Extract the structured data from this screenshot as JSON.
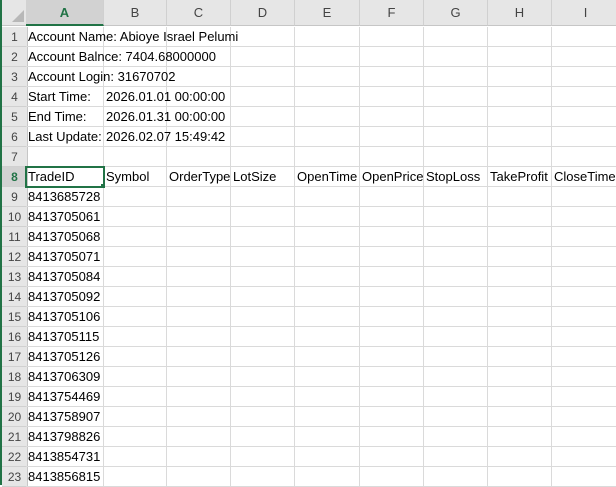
{
  "columns": [
    "A",
    "B",
    "C",
    "D",
    "E",
    "F",
    "G",
    "H",
    "I"
  ],
  "selected_cell": "A8",
  "rows": [
    {
      "num": "1",
      "cells": [
        "Account Name: Abioye Israel Pelumi",
        "",
        "",
        "",
        "",
        "",
        "",
        "",
        ""
      ]
    },
    {
      "num": "2",
      "cells": [
        "Account Balnce: 7404.68000000",
        "",
        "",
        "",
        "",
        "",
        "",
        "",
        ""
      ]
    },
    {
      "num": "3",
      "cells": [
        "Account Login: 31670702",
        "",
        "",
        "",
        "",
        "",
        "",
        "",
        ""
      ]
    },
    {
      "num": "4",
      "cells": [
        "Start Time:",
        "2026.01.01 00:00:00",
        "",
        "",
        "",
        "",
        "",
        "",
        ""
      ]
    },
    {
      "num": "5",
      "cells": [
        "End Time:",
        "2026.01.31 00:00:00",
        "",
        "",
        "",
        "",
        "",
        "",
        ""
      ]
    },
    {
      "num": "6",
      "cells": [
        "Last Update:",
        "2026.02.07 15:49:42",
        "",
        "",
        "",
        "",
        "",
        "",
        ""
      ]
    },
    {
      "num": "7",
      "cells": [
        "",
        "",
        "",
        "",
        "",
        "",
        "",
        "",
        ""
      ]
    },
    {
      "num": "8",
      "cells": [
        "TradeID",
        "Symbol",
        "OrderType",
        "LotSize",
        "OpenTime",
        "OpenPrice",
        "StopLoss",
        "TakeProfit",
        "CloseTime"
      ]
    },
    {
      "num": "9",
      "cells": [
        "8413685728",
        "",
        "",
        "",
        "",
        "",
        "",
        "",
        ""
      ]
    },
    {
      "num": "10",
      "cells": [
        "8413705061",
        "",
        "",
        "",
        "",
        "",
        "",
        "",
        ""
      ]
    },
    {
      "num": "11",
      "cells": [
        "8413705068",
        "",
        "",
        "",
        "",
        "",
        "",
        "",
        ""
      ]
    },
    {
      "num": "12",
      "cells": [
        "8413705071",
        "",
        "",
        "",
        "",
        "",
        "",
        "",
        ""
      ]
    },
    {
      "num": "13",
      "cells": [
        "8413705084",
        "",
        "",
        "",
        "",
        "",
        "",
        "",
        ""
      ]
    },
    {
      "num": "14",
      "cells": [
        "8413705092",
        "",
        "",
        "",
        "",
        "",
        "",
        "",
        ""
      ]
    },
    {
      "num": "15",
      "cells": [
        "8413705106",
        "",
        "",
        "",
        "",
        "",
        "",
        "",
        ""
      ]
    },
    {
      "num": "16",
      "cells": [
        "8413705115",
        "",
        "",
        "",
        "",
        "",
        "",
        "",
        ""
      ]
    },
    {
      "num": "17",
      "cells": [
        "8413705126",
        "",
        "",
        "",
        "",
        "",
        "",
        "",
        ""
      ]
    },
    {
      "num": "18",
      "cells": [
        "8413706309",
        "",
        "",
        "",
        "",
        "",
        "",
        "",
        ""
      ]
    },
    {
      "num": "19",
      "cells": [
        "8413754469",
        "",
        "",
        "",
        "",
        "",
        "",
        "",
        ""
      ]
    },
    {
      "num": "20",
      "cells": [
        "8413758907",
        "",
        "",
        "",
        "",
        "",
        "",
        "",
        ""
      ]
    },
    {
      "num": "21",
      "cells": [
        "8413798826",
        "",
        "",
        "",
        "",
        "",
        "",
        "",
        ""
      ]
    },
    {
      "num": "22",
      "cells": [
        "8413854731",
        "",
        "",
        "",
        "",
        "",
        "",
        "",
        ""
      ]
    },
    {
      "num": "23",
      "cells": [
        "8413856815",
        "",
        "",
        "",
        "",
        "",
        "",
        "",
        ""
      ]
    }
  ]
}
